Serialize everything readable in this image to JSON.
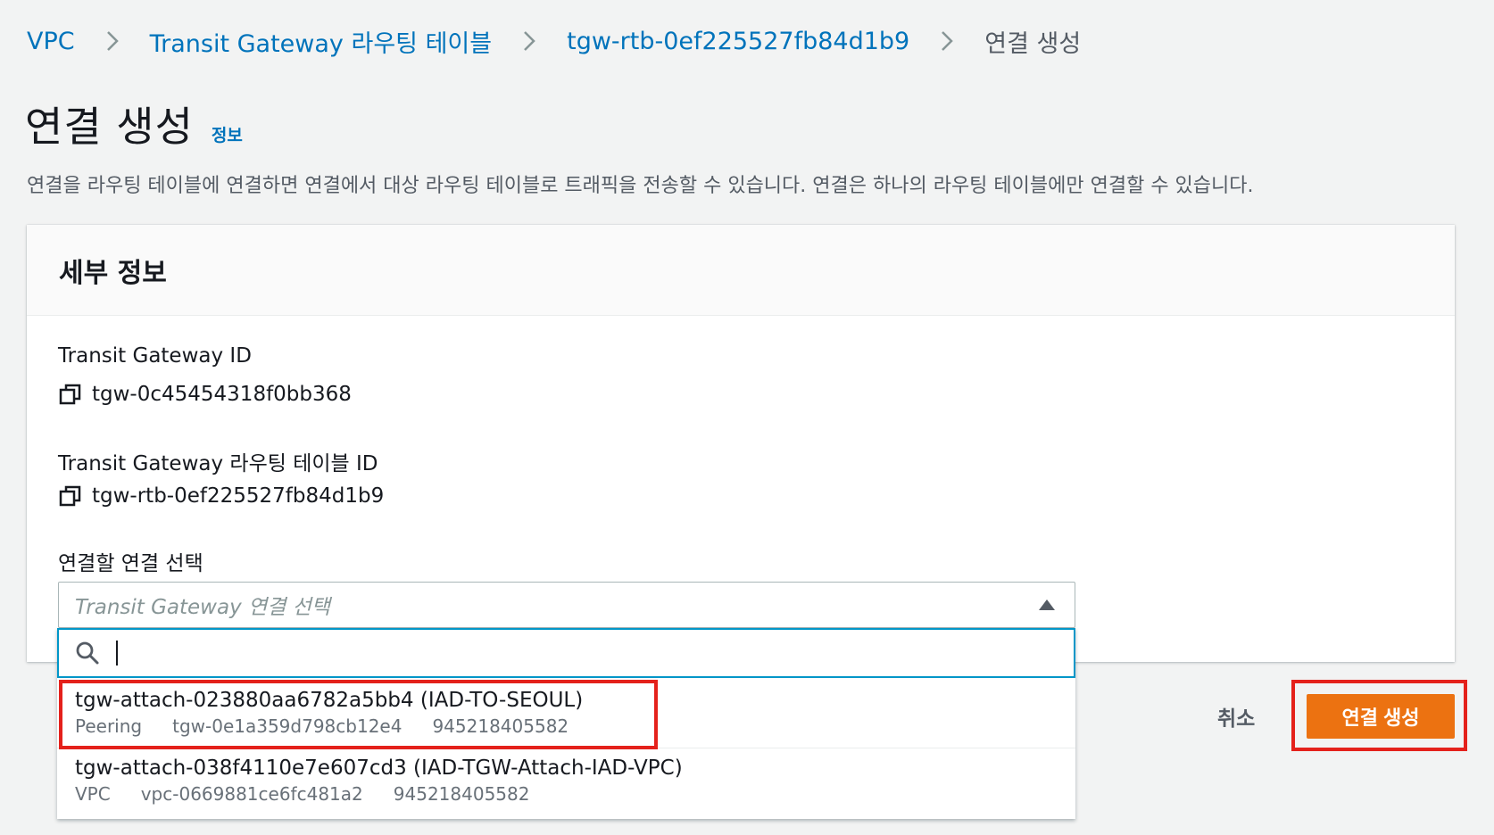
{
  "breadcrumb": {
    "items": [
      "VPC",
      "Transit Gateway 라우팅 테이블",
      "tgw-rtb-0ef225527fb84d1b9"
    ],
    "current": "연결 생성"
  },
  "page": {
    "title": "연결 생성",
    "info_link": "정보",
    "description": "연결을 라우팅 테이블에 연결하면 연결에서 대상 라우팅 테이블로 트래픽을 전송할 수 있습니다. 연결은 하나의 라우팅 테이블에만 연결할 수 있습니다."
  },
  "panel": {
    "title": "세부 정보",
    "tgw_id_label": "Transit Gateway ID",
    "tgw_id_value": "tgw-0c45454318f0bb368",
    "rtb_id_label": "Transit Gateway 라우팅 테이블 ID",
    "rtb_id_value": "tgw-rtb-0ef225527fb84d1b9",
    "select_label": "연결할 연결 선택",
    "select_placeholder": "Transit Gateway 연결 선택"
  },
  "dropdown": {
    "search_value": "",
    "options": [
      {
        "title": "tgw-attach-023880aa6782a5bb4 (IAD-TO-SEOUL)",
        "type": "Peering",
        "resource": "tgw-0e1a359d798cb12e4",
        "account": "945218405582"
      },
      {
        "title": "tgw-attach-038f4110e7e607cd3 (IAD-TGW-Attach-IAD-VPC)",
        "type": "VPC",
        "resource": "vpc-0669881ce6fc481a2",
        "account": "945218405582"
      }
    ]
  },
  "actions": {
    "cancel_label": "취소",
    "create_label": "연결 생성"
  },
  "colors": {
    "link": "#0073bb",
    "primary_button": "#ec7211",
    "highlight": "#e4211b",
    "focus": "#0096c8"
  },
  "icons": [
    "chevron-right-icon",
    "copy-icon",
    "caret-up-icon",
    "search-icon"
  ]
}
